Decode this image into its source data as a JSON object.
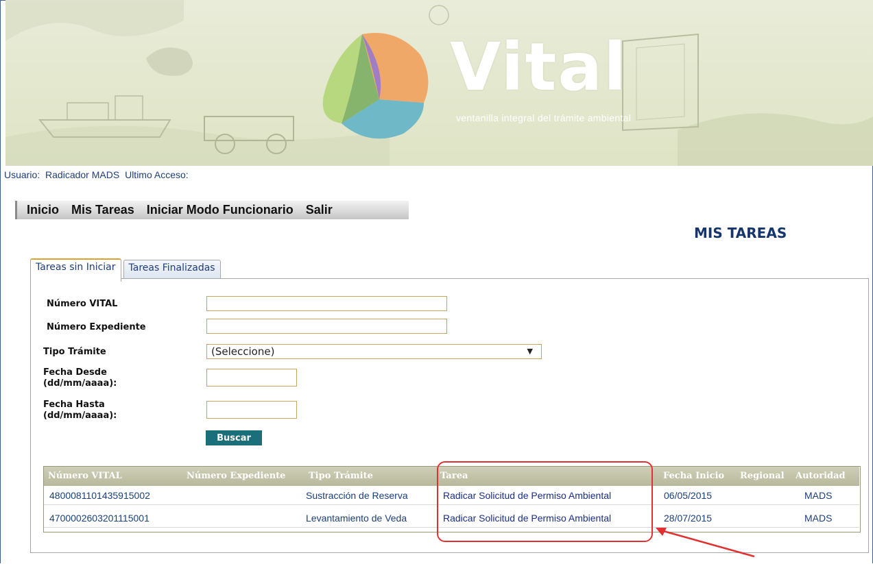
{
  "banner": {
    "title": "Vital",
    "subtitle": "ventanilla integral del trámite ambiental",
    "palette": [
      "#f0a868",
      "#b8d880",
      "#6fb8c8",
      "#a07ec4",
      "#7cae6a"
    ]
  },
  "user": {
    "usuario_label": "Usuario:",
    "usuario_value": "Radicador MADS",
    "ultimo_acceso_label": "Ultimo Acceso:"
  },
  "menu": {
    "items": [
      "Inicio",
      "Mis Tareas",
      "Iniciar Modo Funcionario",
      "Salir"
    ]
  },
  "page_title": "MIS TAREAS",
  "tabs": [
    {
      "label": "Tareas sin Iniciar",
      "active": true
    },
    {
      "label": "Tareas Finalizadas",
      "active": false
    }
  ],
  "form": {
    "numero_vital_label": "Número VITAL",
    "numero_vital_value": "",
    "numero_expediente_label": "Número Expediente",
    "numero_expediente_value": "",
    "tipo_tramite_label": "Tipo Trámite",
    "tipo_tramite_value": "(Seleccione)",
    "fecha_desde_label_1": "Fecha Desde",
    "fecha_desde_label_2": "(dd/mm/aaaa):",
    "fecha_desde_value": "",
    "fecha_hasta_label_1": "Fecha Hasta",
    "fecha_hasta_label_2": "(dd/mm/aaaa):",
    "fecha_hasta_value": "",
    "buscar_label": "Buscar"
  },
  "grid": {
    "columns": [
      "Número VITAL",
      "Número Expediente",
      "Tipo Trámite",
      "Tarea",
      "Fecha Inicio",
      "Regional",
      "Autoridad"
    ],
    "rows": [
      {
        "numero_vital": "4800081101435915002",
        "numero_expediente": "",
        "tipo_tramite": "Sustracción de Reserva",
        "tarea": "Radicar Solicitud de Permiso Ambiental",
        "fecha_inicio": "06/05/2015",
        "regional": "",
        "autoridad": "MADS"
      },
      {
        "numero_vital": "4700002603201115001",
        "numero_expediente": "",
        "tipo_tramite": "Levantamiento de Veda",
        "tarea": "Radicar Solicitud de Permiso Ambiental",
        "fecha_inicio": "28/07/2015",
        "regional": "",
        "autoridad": "MADS"
      }
    ]
  },
  "colors": {
    "accent_button": "#1a6f7a",
    "header_bar": "#b8b89c",
    "annotation": "#e23030",
    "title": "#17356d"
  }
}
